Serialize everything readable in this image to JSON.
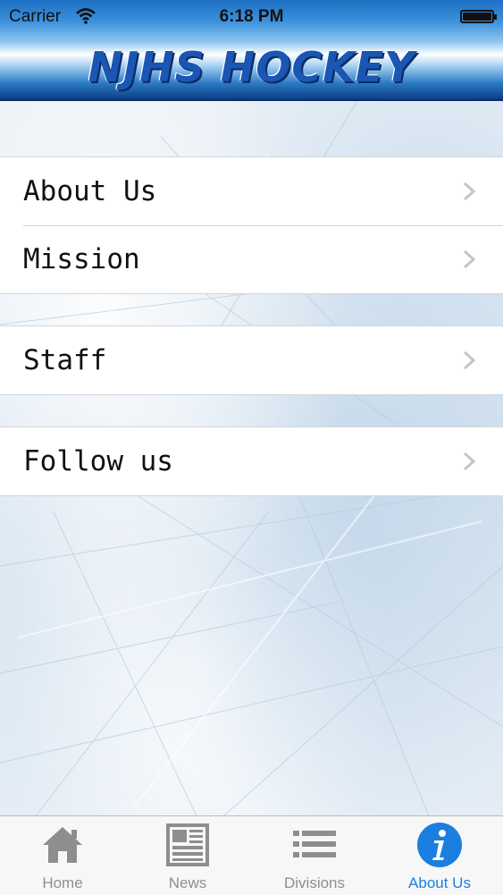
{
  "status_bar": {
    "carrier": "Carrier",
    "time": "6:18 PM"
  },
  "header": {
    "logo_text": "NJHS HOCKEY"
  },
  "menu": {
    "groups": [
      {
        "items": [
          {
            "label": "About Us"
          },
          {
            "label": "Mission"
          }
        ]
      },
      {
        "items": [
          {
            "label": "Staff"
          }
        ]
      },
      {
        "items": [
          {
            "label": "Follow us"
          }
        ]
      }
    ]
  },
  "tab_bar": {
    "tabs": [
      {
        "label": "Home",
        "icon": "house-icon",
        "active": false
      },
      {
        "label": "News",
        "icon": "newspaper-icon",
        "active": false
      },
      {
        "label": "Divisions",
        "icon": "list-icon",
        "active": false
      },
      {
        "label": "About Us",
        "icon": "info-icon",
        "active": true
      }
    ]
  },
  "colors": {
    "accent": "#1a7fe0",
    "inactive_tab": "#8e8e8e",
    "logo": "#1a56b4"
  }
}
